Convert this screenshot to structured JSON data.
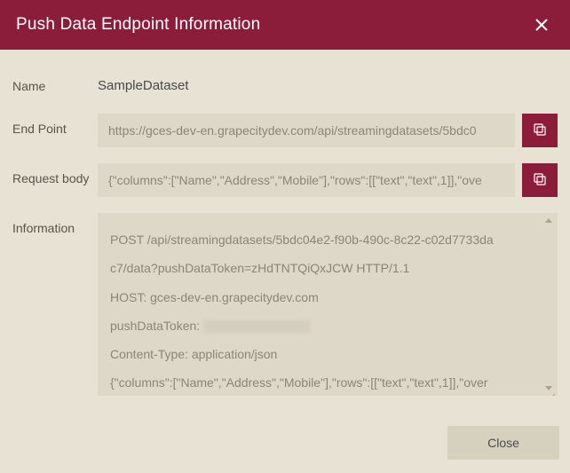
{
  "colors": {
    "accent": "#8b1d3a",
    "panel": "#e7e2d4",
    "field": "#ded8c8"
  },
  "title": "Push Data Endpoint Information",
  "labels": {
    "name": "Name",
    "endpoint": "End Point",
    "requestBody": "Request body",
    "information": "Information"
  },
  "name": "SampleDataset",
  "endpoint": "https://gces-dev-en.grapecitydev.com/api/streamingdatasets/5bdc0",
  "requestBody": "{\"columns\":[\"Name\",\"Address\",\"Mobile\"],\"rows\":[[\"text\",\"text\",1]],\"ove",
  "information": {
    "line1": "POST /api/streamingdatasets/5bdc04e2-f90b-490c-8c22-c02d7733da",
    "line2": "c7/data?pushDataToken=zHdTNTQiQxJCW HTTP/1.1",
    "line3": "HOST: gces-dev-en.grapecitydev.com",
    "line4_prefix": "pushDataToken: ",
    "line5": "Content-Type: application/json",
    "line6": "{\"columns\":[\"Name\",\"Address\",\"Mobile\"],\"rows\":[[\"text\",\"text\",1]],\"over"
  },
  "buttons": {
    "close": "Close"
  }
}
